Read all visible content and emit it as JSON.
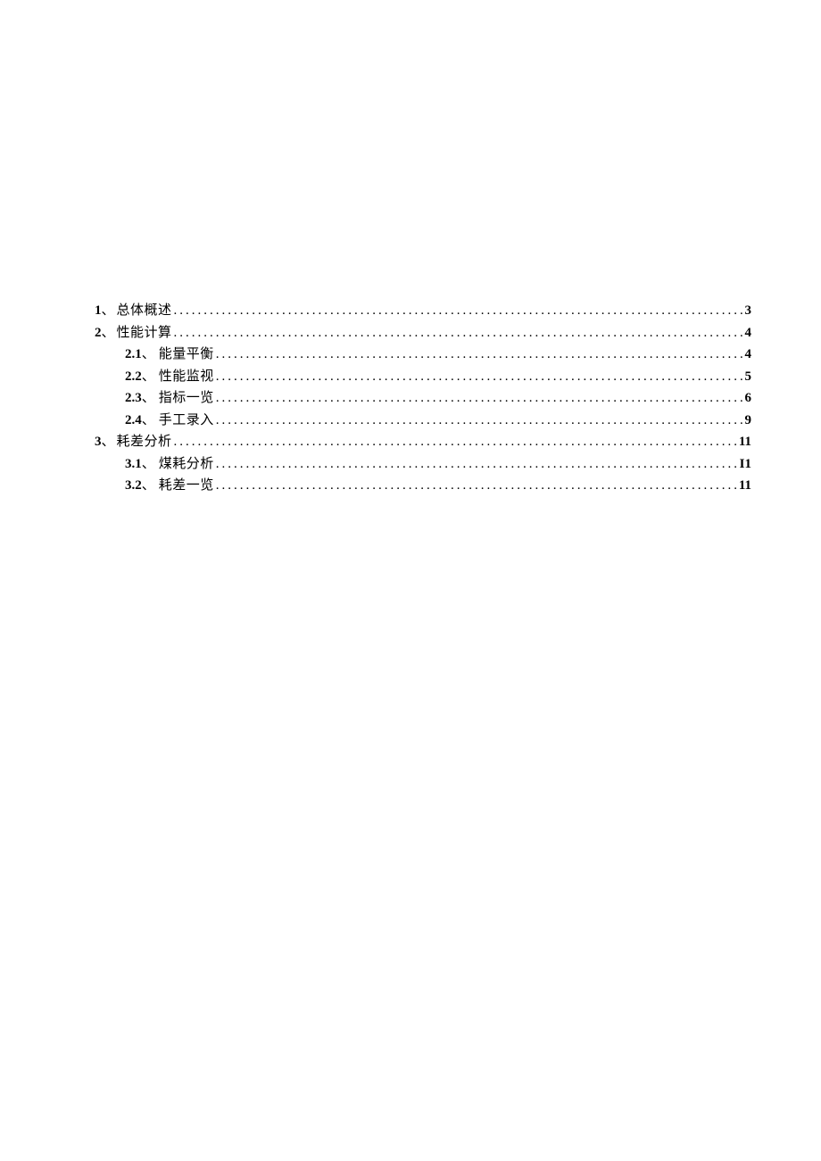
{
  "toc": [
    {
      "level": 1,
      "num": "1",
      "sep": "、",
      "title": "总体概述",
      "page": "3"
    },
    {
      "level": 1,
      "num": "2",
      "sep": "、",
      "title": "性能计算",
      "page": "4"
    },
    {
      "level": 2,
      "num": "2.1",
      "sep": "、",
      "title": "能量平衡",
      "page": "4"
    },
    {
      "level": 2,
      "num": "2.2",
      "sep": "、",
      "title": "性能监视",
      "page": "5"
    },
    {
      "level": 2,
      "num": "2.3",
      "sep": "、",
      "title": "指标一览",
      "page": "6"
    },
    {
      "level": 2,
      "num": "2.4",
      "sep": "、",
      "title": "手工录入",
      "page": "9"
    },
    {
      "level": 1,
      "num": "3",
      "sep": "、",
      "title": "耗差分析",
      "page": "11"
    },
    {
      "level": 2,
      "num": "3.1",
      "sep": "、",
      "title": "煤耗分析",
      "page": "I1"
    },
    {
      "level": 2,
      "num": "3.2",
      "sep": "、",
      "title": "耗差一览",
      "page": "11"
    }
  ]
}
